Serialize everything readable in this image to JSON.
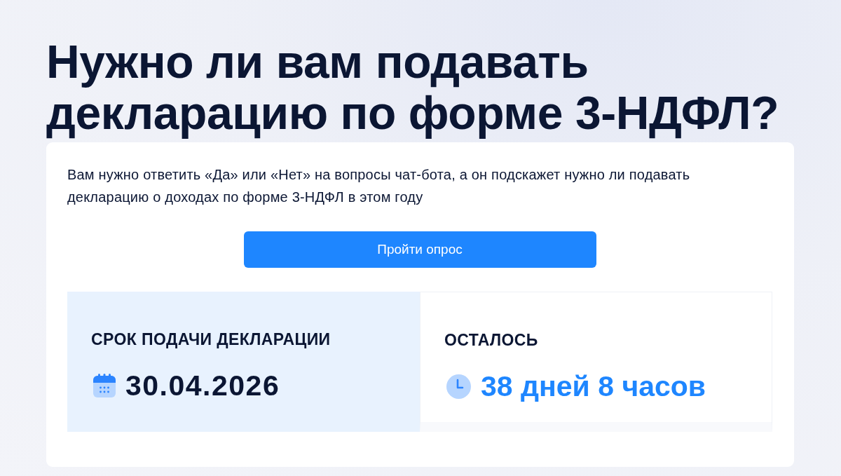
{
  "title": "Нужно ли вам подавать декларацию по форме 3-НДФЛ?",
  "card": {
    "description": "Вам нужно ответить «Да» или «Нет» на вопросы чат-бота, а он подскажет нужно ли подавать декларацию о доходах по форме 3-НДФЛ в этом году",
    "button": "Пройти опрос",
    "panels": [
      {
        "kind": "deadline",
        "label": "СРОК ПОДАЧИ ДЕКЛАРАЦИИ",
        "value": "30.04.2026"
      },
      {
        "kind": "remaining",
        "label": "ОСТАЛОСЬ",
        "value": "38 дней 8 часов"
      }
    ]
  }
}
